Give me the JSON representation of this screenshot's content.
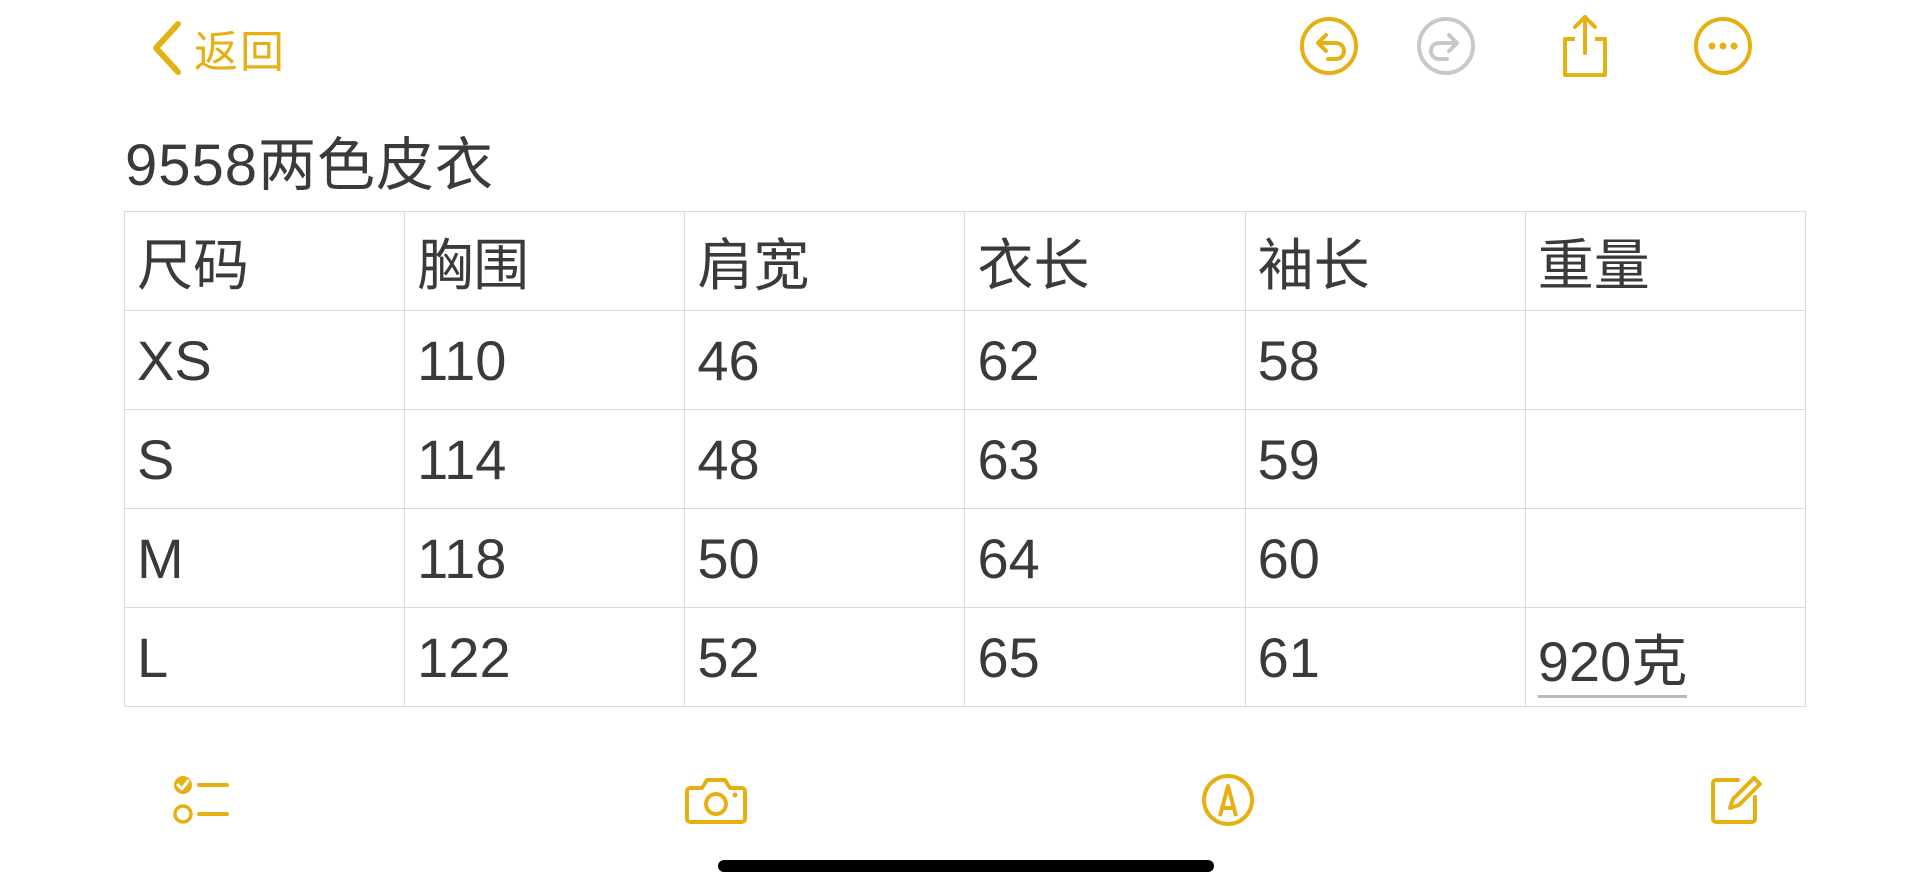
{
  "colors": {
    "accent": "#e6b013",
    "disabled": "#c7c7cc",
    "text": "#3a3a3c",
    "grid": "#dadade"
  },
  "toolbar": {
    "back_label": "返回",
    "icons": [
      "undo-icon",
      "redo-icon",
      "share-icon",
      "more-icon"
    ]
  },
  "note": {
    "title": "9558两色皮衣"
  },
  "table": {
    "headers": [
      "尺码",
      "胸围",
      "肩宽",
      "衣长",
      "袖长",
      "重量"
    ],
    "rows": [
      [
        "XS",
        "110",
        "46",
        "62",
        "58",
        ""
      ],
      [
        "S",
        "114",
        "48",
        "63",
        "59",
        ""
      ],
      [
        "M",
        "118",
        "50",
        "64",
        "60",
        ""
      ],
      [
        "L",
        "122",
        "52",
        "65",
        "61",
        "920克"
      ]
    ]
  },
  "bottom_toolbar": {
    "icons": [
      "checklist-icon",
      "camera-icon",
      "markup-icon",
      "compose-icon"
    ]
  }
}
